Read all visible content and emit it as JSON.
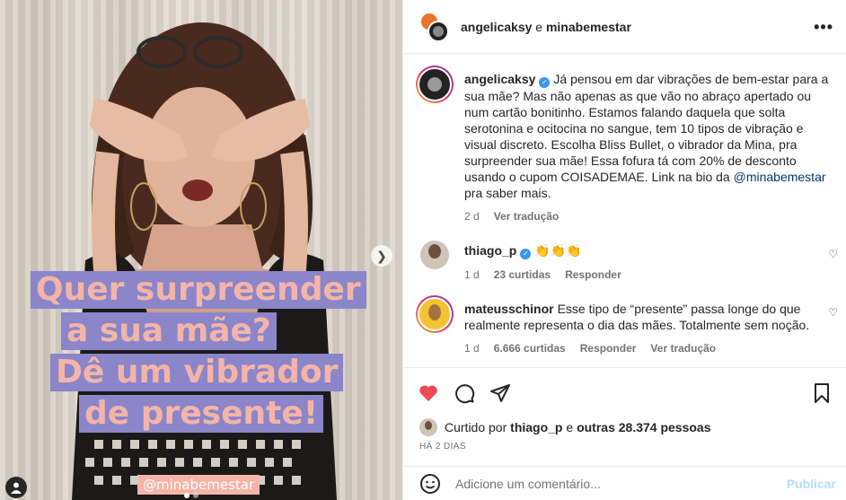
{
  "media": {
    "overlay_lines": [
      "Quer surpreender",
      "a sua mãe?",
      "Dê um vibrador",
      "de presente!"
    ],
    "handle_tag": "@minabemestar",
    "colors": {
      "overlay_bg": "#8a86c9",
      "overlay_text": "#f5b4a8"
    }
  },
  "header": {
    "user1": "angelicaksy",
    "and": "e",
    "user2": "minabemestar",
    "more_icon": "more-horizontal-icon"
  },
  "caption": {
    "username": "angelicaksy",
    "text_before": "Já pensou em dar vibrações de bem-estar para a sua mãe? Mas não apenas as que vão no abraço apertado ou num cartão bonitinho. Estamos falando daquela que solta serotonina e ocitocina no sangue, tem 10 tipos de vibração e visual discreto. Escolha Bliss Bullet, o vibrador da Mina, pra surpreender sua mãe! Essa fofura tá com 20% de desconto usando o cupom COISADEMAE. Link na bio da ",
    "mention": "@minabemestar",
    "text_after": " pra saber mais.",
    "time": "2 d",
    "translate": "Ver tradução"
  },
  "comments": [
    {
      "username": "thiago_p",
      "text": "👏👏👏",
      "time": "1 d",
      "likes": "23 curtidas",
      "reply": "Responder"
    },
    {
      "username": "mateusschinor",
      "text": "Esse tipo de “presente” passa longe do que realmente representa o dia das mães. Totalmente sem noção.",
      "time": "1 d",
      "likes": "6.666 curtidas",
      "reply": "Responder",
      "translate": "Ver tradução"
    }
  ],
  "likes": {
    "prefix": "Curtido por",
    "user": "thiago_p",
    "middle": "e",
    "others": "outras 28.374 pessoas"
  },
  "time_ago": "HÁ 2 DIAS",
  "add_comment": {
    "placeholder": "Adicione um comentário...",
    "publish": "Publicar"
  },
  "colors": {
    "like_red": "#ed4956",
    "verified_blue": "#3897f0",
    "publish_disabled": "#b2dffc"
  }
}
